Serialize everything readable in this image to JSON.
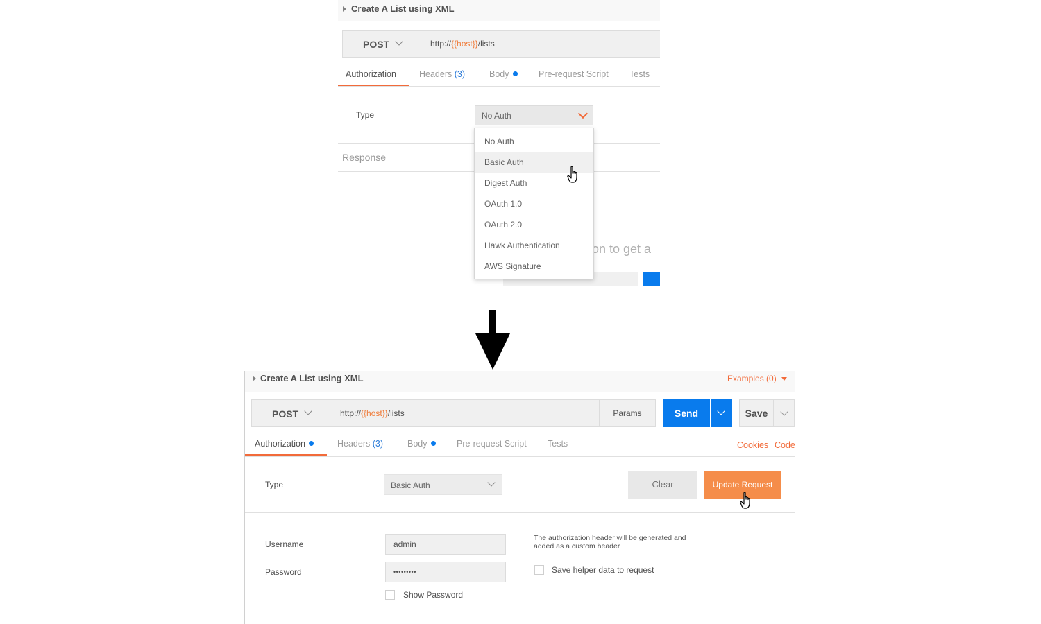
{
  "before": {
    "request_title": "Create A List using XML",
    "method": "POST",
    "url_prefix": "http://",
    "url_var": "{{host}}",
    "url_suffix": "/lists",
    "tabs": {
      "authorization": "Authorization",
      "headers": "Headers",
      "headers_count": "(3)",
      "body": "Body",
      "prerequest": "Pre-request Script",
      "tests": "Tests"
    },
    "type_label": "Type",
    "type_value": "No Auth",
    "response_label": "Response",
    "hint_fragment": "tton to get a",
    "menu_items": [
      "No Auth",
      "Basic Auth",
      "Digest Auth",
      "OAuth 1.0",
      "OAuth 2.0",
      "Hawk Authentication",
      "AWS Signature"
    ],
    "hovered_item": "Basic Auth"
  },
  "after": {
    "request_title": "Create A List using XML",
    "examples_label": "Examples (0)",
    "method": "POST",
    "url_prefix": "http://",
    "url_var": "{{host}}",
    "url_suffix": "/lists",
    "params_label": "Params",
    "send_label": "Send",
    "save_label": "Save",
    "tabs": {
      "authorization": "Authorization",
      "headers": "Headers",
      "headers_count": "(3)",
      "body": "Body",
      "prerequest": "Pre-request Script",
      "tests": "Tests"
    },
    "cookies_label": "Cookies",
    "code_label": "Code",
    "type_label": "Type",
    "type_value": "Basic Auth",
    "clear_label": "Clear",
    "update_label": "Update Request",
    "username_label": "Username",
    "username_value": "admin",
    "password_label": "Password",
    "password_value": "•••••••••",
    "show_password_label": "Show Password",
    "info_text_line1": "The authorization header will be generated and",
    "info_text_line2": "added as a custom header",
    "save_helper_label": "Save helper data to request"
  },
  "colors": {
    "accent_orange": "#f26b3a",
    "url_variable": "#f07c3a",
    "send_blue": "#097bed",
    "update_orange": "#f58d4a",
    "dot_blue": "#097bed"
  },
  "icons": [
    "caret-right-icon",
    "chevron-down-icon",
    "dropdown-caret-icon",
    "pointer-hand-icon",
    "down-arrow-icon"
  ]
}
